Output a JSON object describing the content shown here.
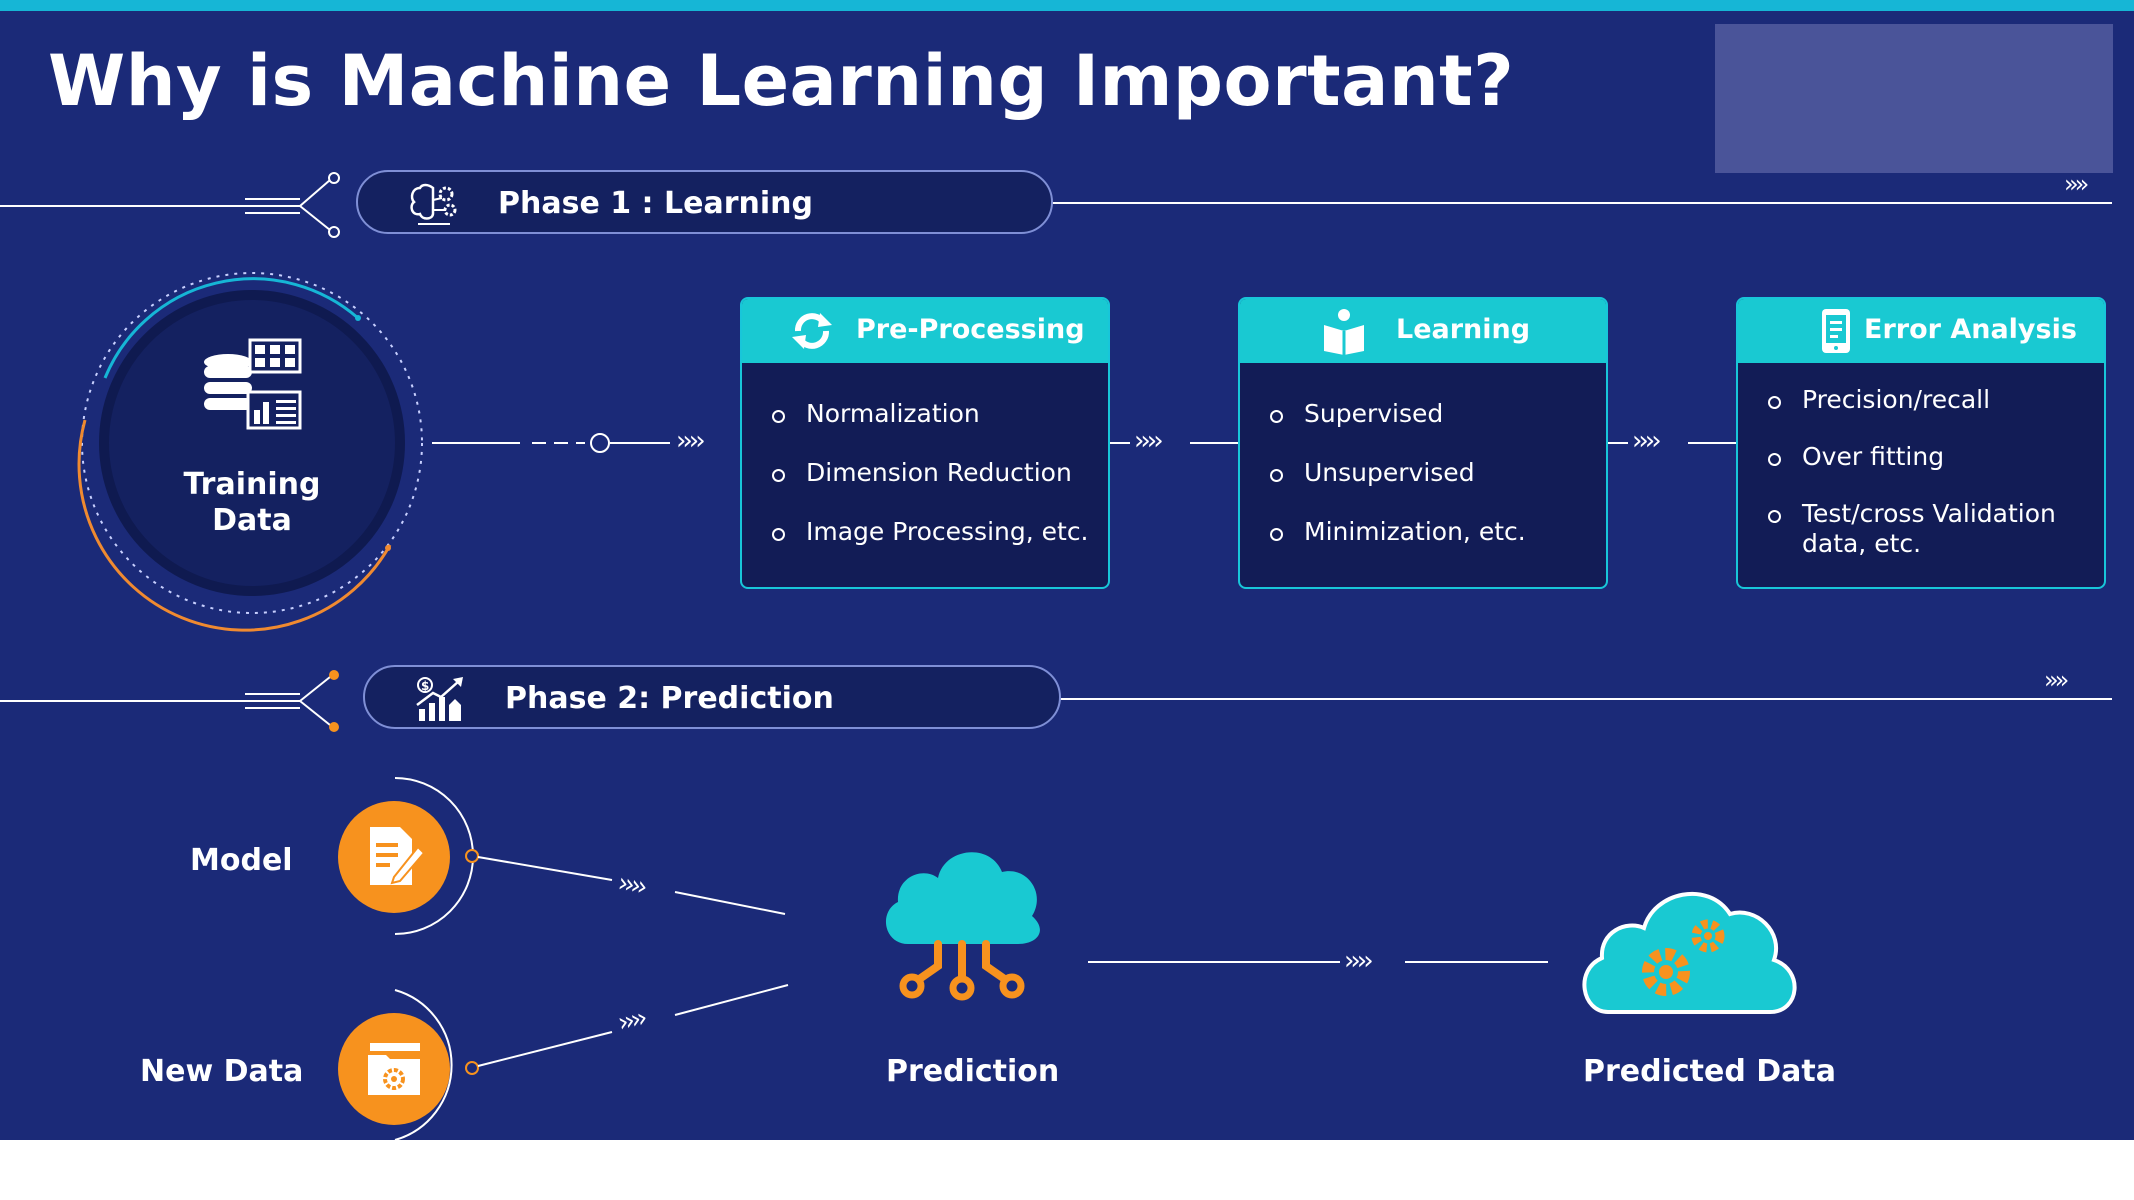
{
  "title": "Why is Machine Learning Important?",
  "phase1": {
    "label": "Phase 1 : Learning",
    "icon": "brain-gears-icon"
  },
  "phase2": {
    "label": "Phase 2: Prediction",
    "icon": "growth-chart-icon"
  },
  "training_data": {
    "label_line1": "Training",
    "label_line2": "Data",
    "icon": "database-grid-chart-icon"
  },
  "cards": [
    {
      "title": "Pre-Processing",
      "icon": "refresh-cycle-icon",
      "items": [
        "Normalization",
        "Dimension Reduction",
        "Image Processing, etc."
      ]
    },
    {
      "title": "Learning",
      "icon": "reading-person-icon",
      "items": [
        "Supervised",
        "Unsupervised",
        "Minimization, etc."
      ]
    },
    {
      "title": "Error Analysis",
      "icon": "mobile-report-icon",
      "items": [
        "Precision/recall",
        "Over fitting",
        "Test/cross Validation data, etc."
      ]
    }
  ],
  "prediction_flow": {
    "model_label": "Model",
    "new_data_label": "New Data",
    "prediction_label": "Prediction",
    "predicted_data_label": "Predicted Data",
    "model_icon": "document-edit-icon",
    "new_data_icon": "folder-gear-icon",
    "prediction_icon": "cloud-network-icon",
    "predicted_data_icon": "cloud-gears-icon"
  },
  "flow_arrows": "››››",
  "end_arrows": "»»",
  "colors": {
    "background": "#1b2a78",
    "accent_cyan": "#19c9d2",
    "accent_orange": "#f7921e",
    "top_bar": "#16b6d6"
  }
}
